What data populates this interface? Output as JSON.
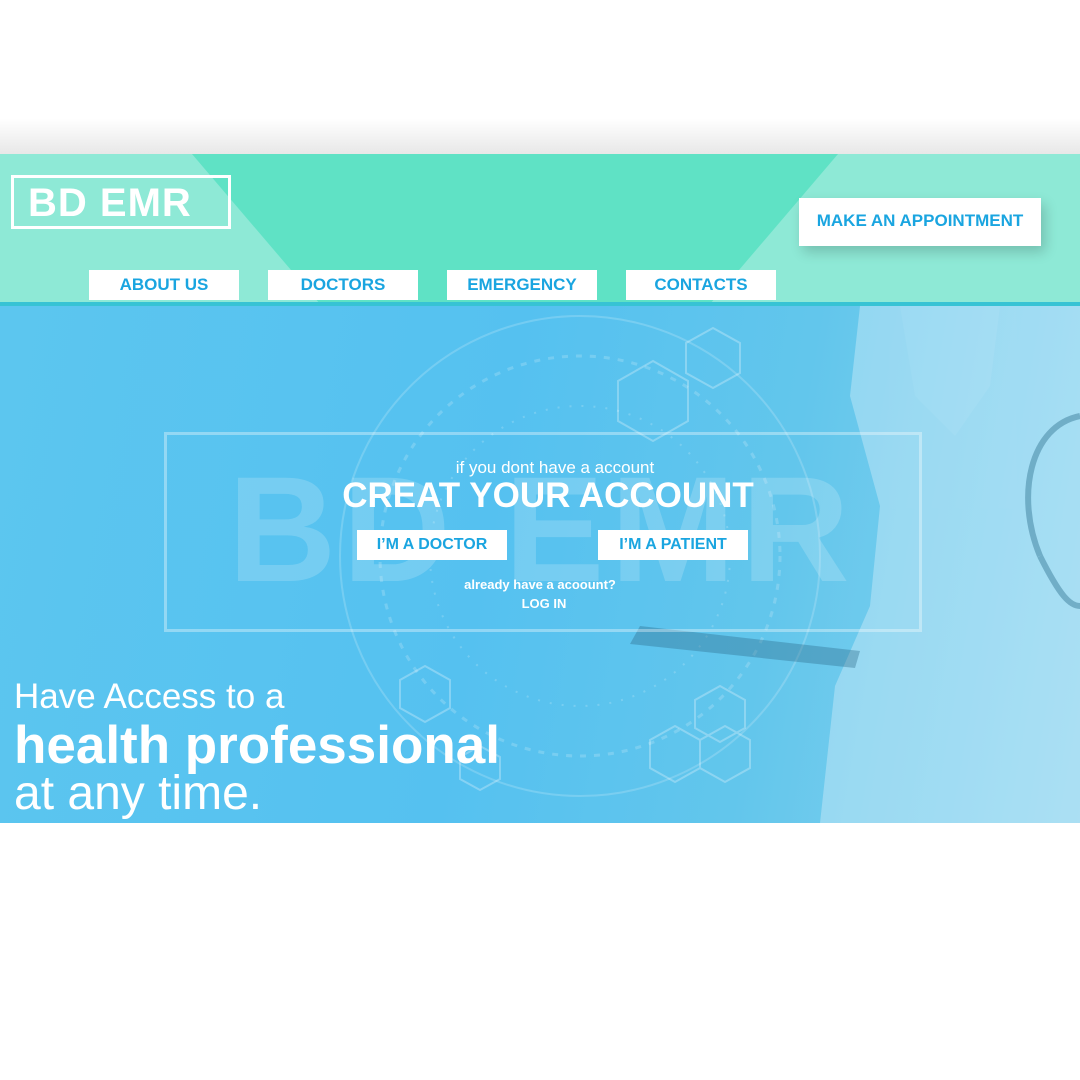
{
  "header": {
    "logo": "BD EMR",
    "appointment_label": "MAKE AN APPOINTMENT",
    "nav": [
      {
        "label": "ABOUT US"
      },
      {
        "label": "DOCTORS"
      },
      {
        "label": "EMERGENCY"
      },
      {
        "label": "CONTACTS"
      }
    ]
  },
  "signup": {
    "watermark": "BD EMR",
    "subtitle": "if you dont have a account",
    "title": "CREAT YOUR ACCOUNT",
    "doctor_label": "I’M A DOCTOR",
    "patient_label": "I’M A PATIENT",
    "already_text": "already have a acoount?",
    "login_label": "LOG IN"
  },
  "hero": {
    "line1": "Have Access to a",
    "line2": "health professional",
    "line3": "at any time."
  },
  "colors": {
    "header_bg": "#8ee9d6",
    "header_band": "#5fe2c5",
    "accent_text": "#1aa5e0",
    "hero_bg": "#4fbff0"
  }
}
